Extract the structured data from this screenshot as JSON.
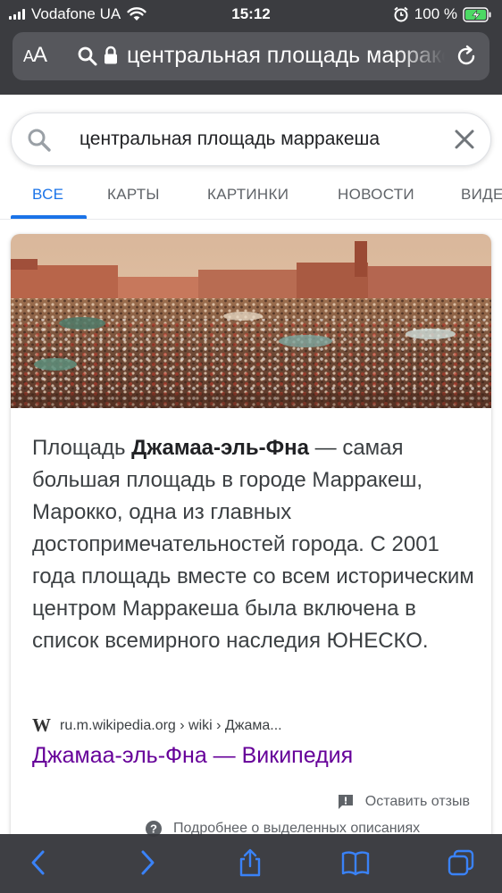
{
  "status_bar": {
    "carrier": "Vodafone UA",
    "time": "15:12",
    "battery": "100 %"
  },
  "browser": {
    "text_size_button": "AA",
    "url": "центральная площадь марракеша"
  },
  "search": {
    "query": "центральная площадь марракеша"
  },
  "tabs": [
    {
      "label": "ВСЕ",
      "active": true
    },
    {
      "label": "КАРТЫ",
      "active": false
    },
    {
      "label": "КАРТИНКИ",
      "active": false
    },
    {
      "label": "НОВОСТИ",
      "active": false
    },
    {
      "label": "ВИДЕО",
      "active": false
    }
  ],
  "result": {
    "snippet_start": "Площадь ",
    "snippet_bold": "Джамаа-эль-Фна",
    "snippet_rest": " — самая большая площадь в городе Марракеш, Марокко, одна из главных достопримечательностей города. С 2001 года площадь вместе со всем историческим центром Марракеша была включена в список всемирного наследия ЮНЕСКО.",
    "source_icon": "W",
    "source_path": "ru.m.wikipedia.org › wiki › Джама...",
    "link_title": "Джамаа-эль-Фна — Википедия",
    "feedback_label": "Оставить отзыв",
    "more_info_label": "Подробнее о выделенных описаниях"
  },
  "colors": {
    "accent": "#1a73e8",
    "visited_link": "#660099",
    "browser_chrome": "#3b3c40",
    "toolbar_icon": "#3a82f7",
    "battery_green": "#4cd964"
  },
  "icons": {
    "address_search": "magnifier-icon",
    "lock": "lock-icon",
    "reload": "reload-icon",
    "search": "search-icon",
    "clear": "close-icon",
    "feedback": "feedback-icon",
    "help": "help-icon",
    "back": "chevron-left-icon",
    "forward": "chevron-right-icon",
    "share": "share-icon",
    "bookmarks": "book-icon",
    "tabs": "tabs-icon"
  }
}
